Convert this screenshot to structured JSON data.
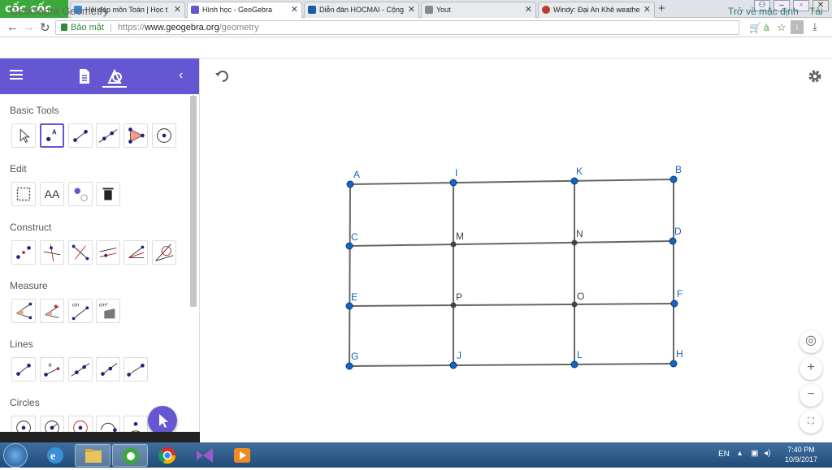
{
  "browser": {
    "logo": "cốc cốc",
    "tabs": [
      {
        "label": "Hỏi đáp môn Toán | Học t",
        "favicon_color": "#3b8ad8"
      },
      {
        "label": "Hình học - GeoGebra",
        "favicon_color": "#6557d2"
      },
      {
        "label": "Diễn đàn HOCMAI - Cộng",
        "favicon_color": "#1a5ea8"
      },
      {
        "label": "Yout",
        "favicon_color": "#888888"
      },
      {
        "label": "Windy: Đại An Khê weathe",
        "favicon_color": "#c0392b"
      }
    ],
    "new_tab": "+",
    "secure_label": "Bảo mật",
    "url_prefix": "https://",
    "url_host": "www.geogebra.org",
    "url_path": "/geometry"
  },
  "app": {
    "title": "GeoGebra Geometry",
    "reset_label": "Trở về mặc định",
    "download_label": "Tải"
  },
  "sidebar": {
    "sections": [
      {
        "title": "Basic Tools",
        "tools": [
          "move",
          "point",
          "segment",
          "line",
          "polygon",
          "circle-center-point"
        ]
      },
      {
        "title": "Edit",
        "tools": [
          "select",
          "text-style",
          "show-hide",
          "delete"
        ]
      },
      {
        "title": "Construct",
        "tools": [
          "midpoint",
          "perpendicular",
          "perpendicular-bisector",
          "parallel",
          "angle-bisector",
          "tangents"
        ]
      },
      {
        "title": "Measure",
        "tools": [
          "angle",
          "angle-given-size",
          "distance",
          "area"
        ]
      },
      {
        "title": "Lines",
        "tools": [
          "segment",
          "segment-given-length",
          "line",
          "ray",
          "vector"
        ]
      },
      {
        "title": "Circles",
        "tools": [
          "circle-center-point",
          "circle-center-radius",
          "compass",
          "semicircle",
          "arc"
        ]
      }
    ],
    "measure_cm": "cm",
    "measure_cm2": "cm²",
    "text_style_label": "AA",
    "segment_label": "a"
  },
  "geometry": {
    "points": [
      {
        "name": "A"
      },
      {
        "name": "I"
      },
      {
        "name": "K"
      },
      {
        "name": "B"
      },
      {
        "name": "C"
      },
      {
        "name": "M"
      },
      {
        "name": "N"
      },
      {
        "name": "D"
      },
      {
        "name": "E"
      },
      {
        "name": "P"
      },
      {
        "name": "O"
      },
      {
        "name": "F"
      },
      {
        "name": "G"
      },
      {
        "name": "J"
      },
      {
        "name": "L"
      },
      {
        "name": "H"
      }
    ],
    "point_color": "#1565c0",
    "inner_point_color": "#444444",
    "line_color": "#666666",
    "label_color": "#1565c0"
  },
  "canvas_controls": [
    "locate-icon",
    "zoom-in-icon",
    "zoom-out-icon",
    "fullscreen-icon"
  ],
  "taskbar": {
    "lang": "EN",
    "time": "7:40 PM",
    "date": "10/9/2017"
  }
}
